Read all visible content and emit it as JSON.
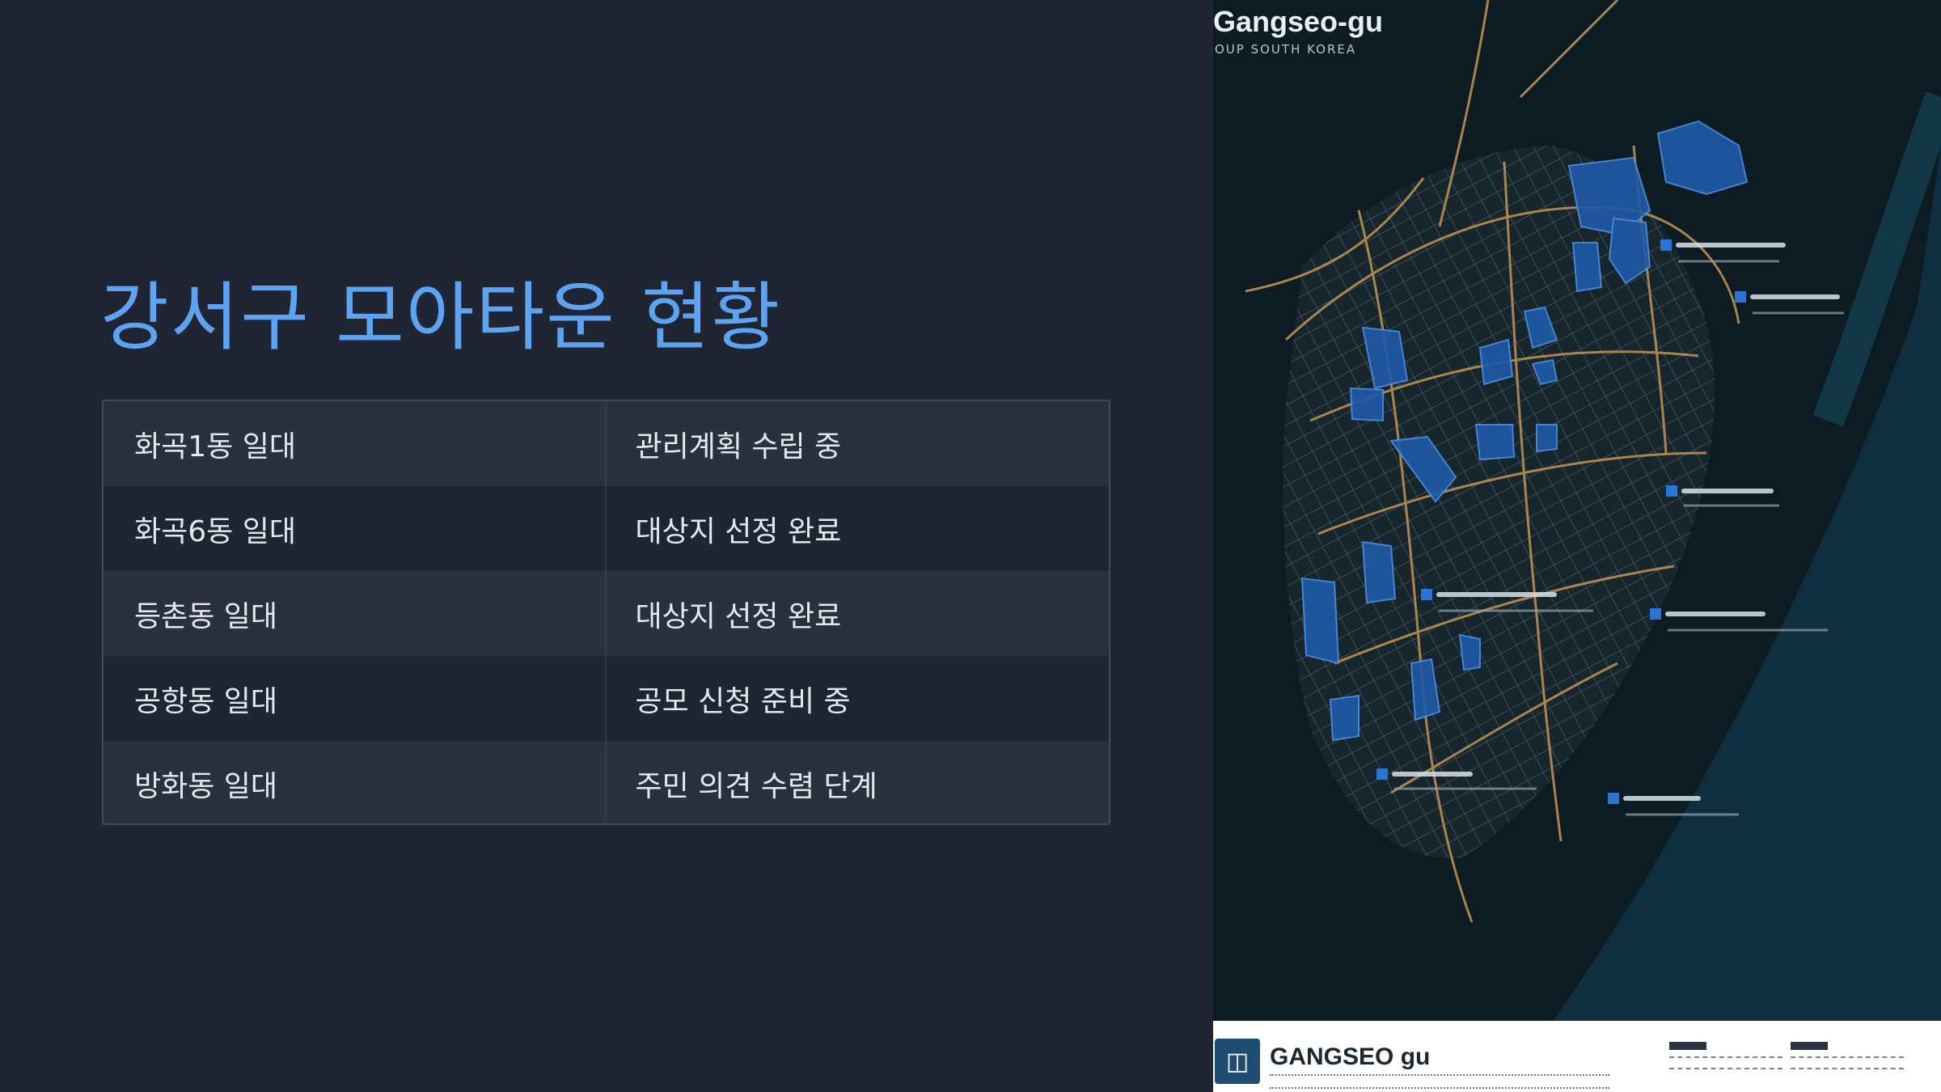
{
  "slide": {
    "title": "강서구 모아타운 현황"
  },
  "table": {
    "rows": [
      {
        "area": "화곡1동 일대",
        "status": "관리계획 수립 중"
      },
      {
        "area": "화곡6동 일대",
        "status": "대상지 선정 완료"
      },
      {
        "area": "등촌동 일대",
        "status": "대상지 선정 완료"
      },
      {
        "area": "공항동 일대",
        "status": "공모 신청 준비 중"
      },
      {
        "area": "방화동 일대",
        "status": "주민 의견 수렴 단계"
      }
    ]
  },
  "map": {
    "title": "Gangseo-gu",
    "subtitle": "OUP SOUTH KOREA",
    "legend_title": "GANGSEO gu",
    "icon": "car-icon",
    "colors": {
      "water": "#0f2e3f",
      "land": "#0d1b22",
      "road": "#b98f52",
      "highlight": "#1f5aa8"
    }
  }
}
